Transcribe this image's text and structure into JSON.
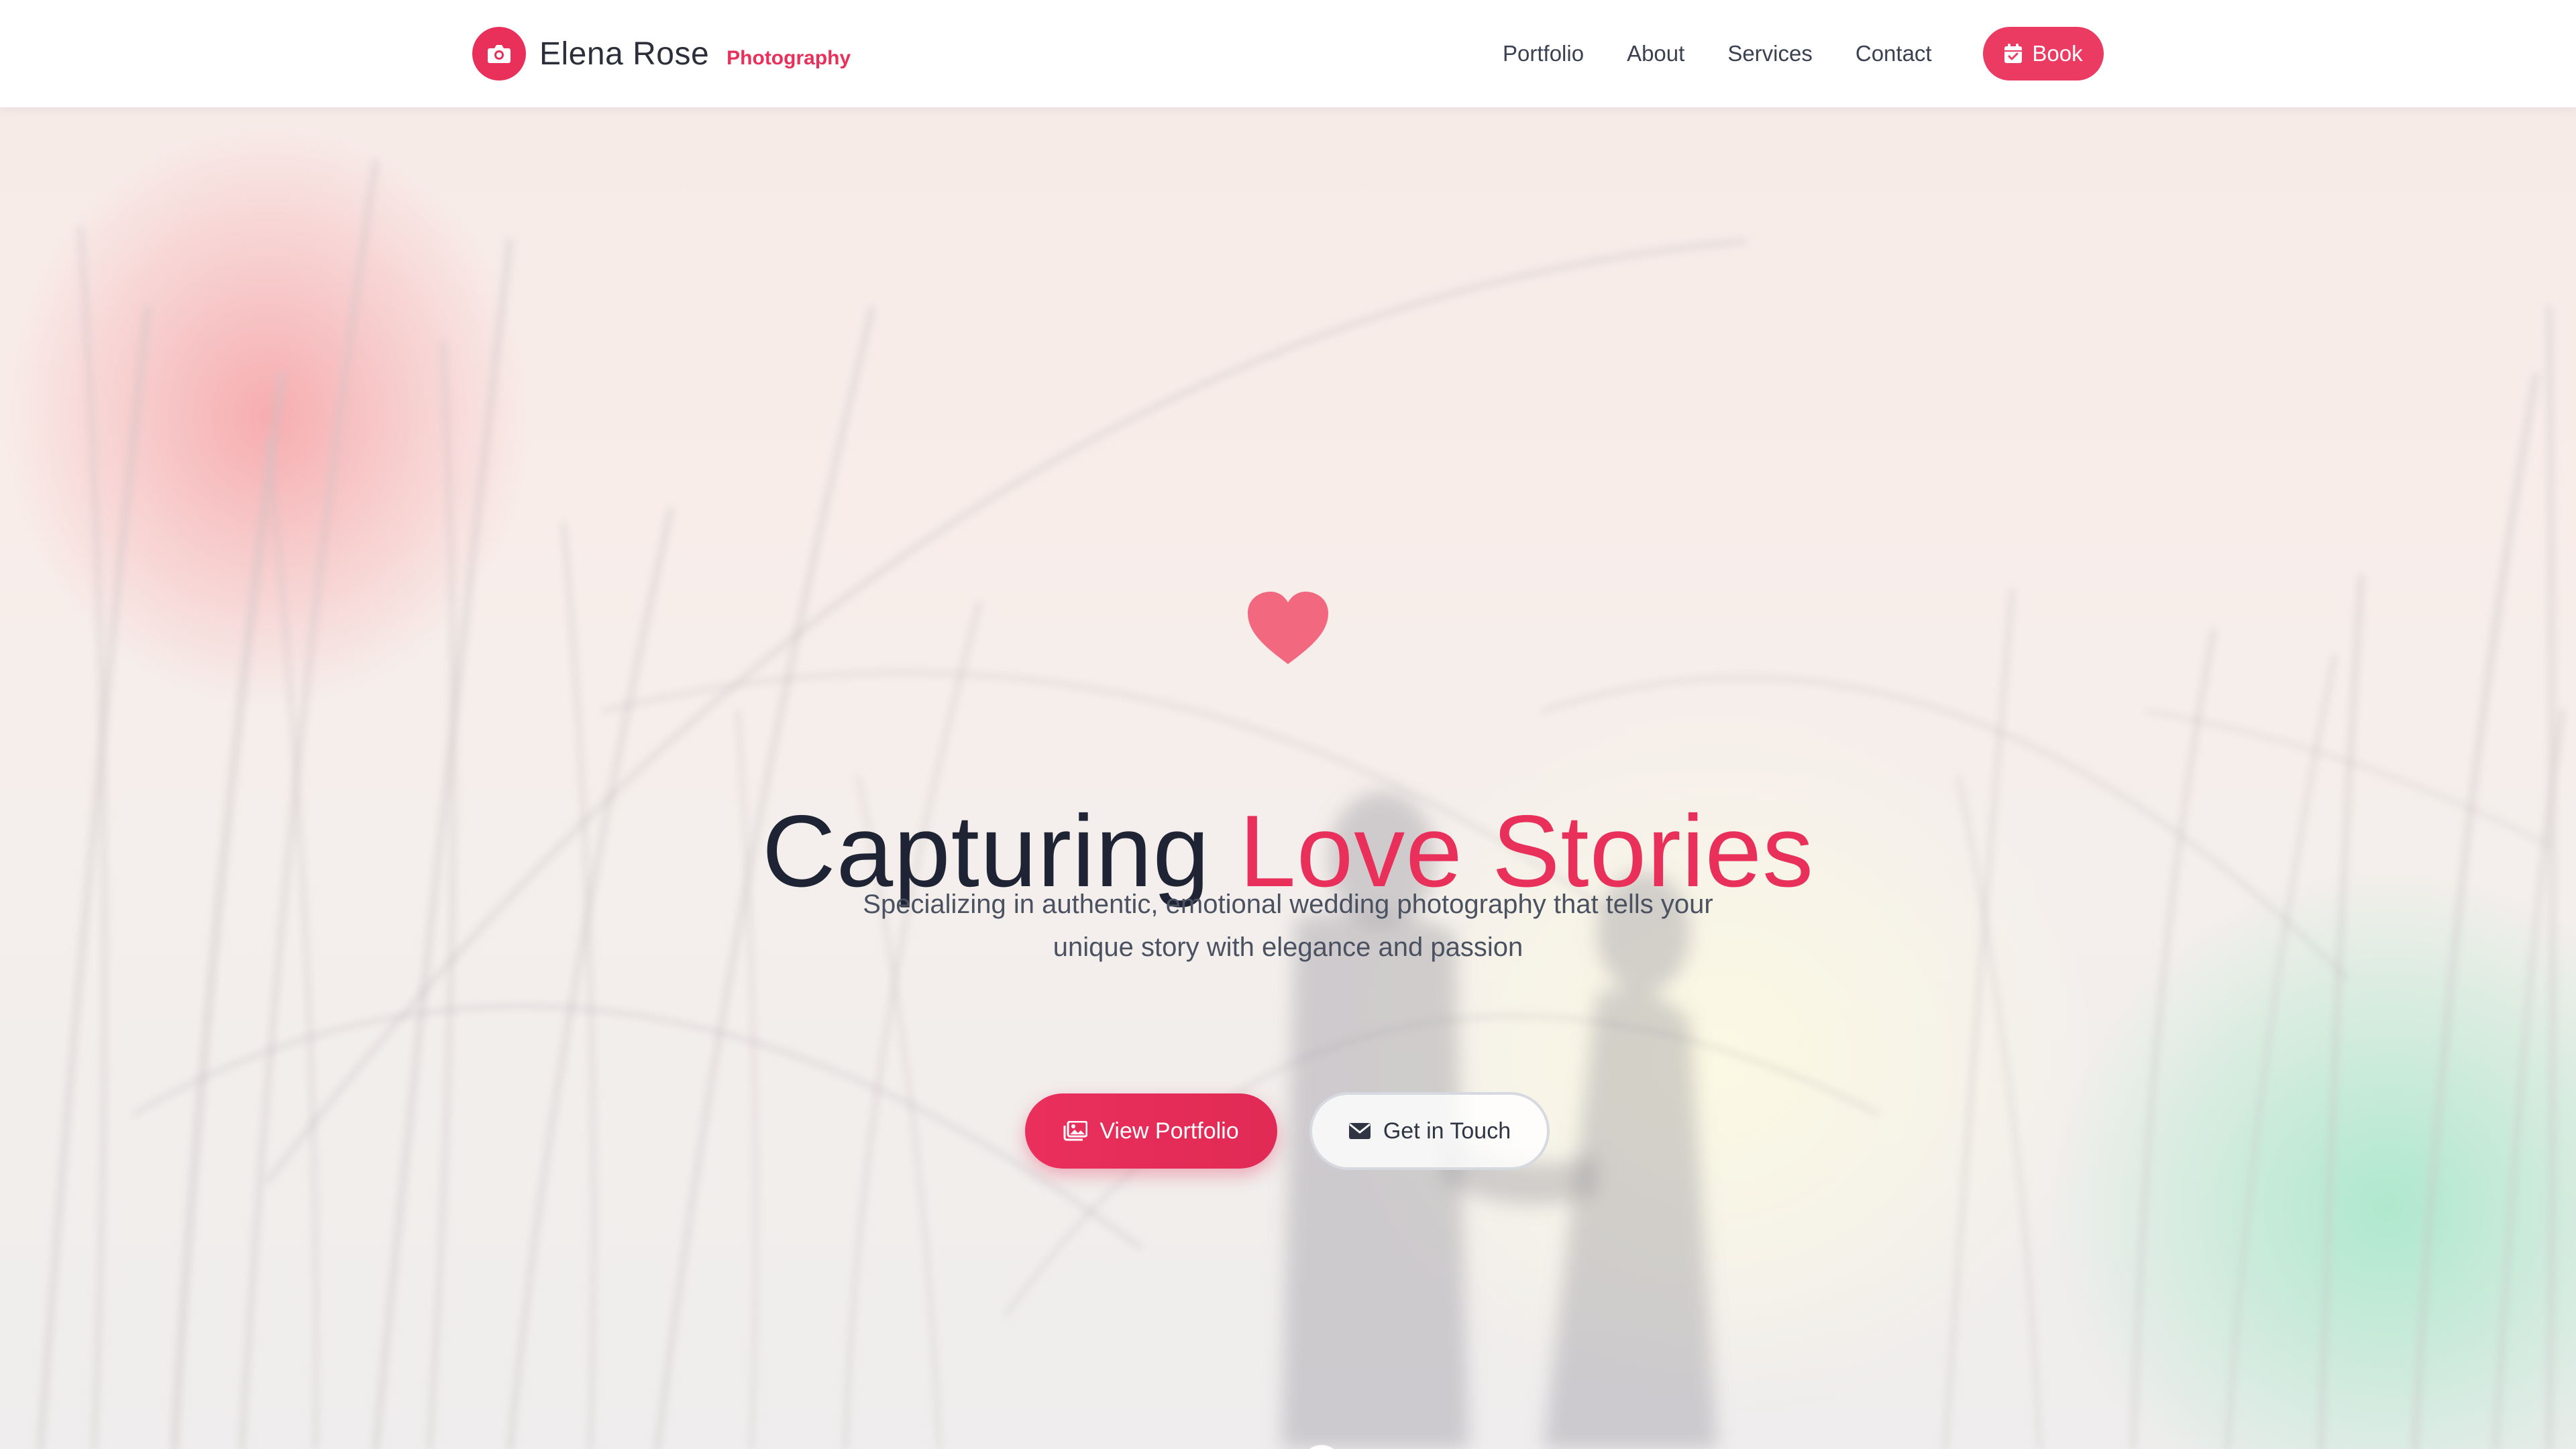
{
  "brand": {
    "name": "Elena Rose",
    "tagline": "Photography",
    "logo_icon": "camera-icon"
  },
  "nav": {
    "links": [
      "Portfolio",
      "About",
      "Services",
      "Contact"
    ],
    "book_label": "Book",
    "book_icon": "calendar-check-icon"
  },
  "hero": {
    "icon": "heart-icon",
    "title_main": "Capturing",
    "title_accent": "Love Stories",
    "subtitle": "Specializing in authentic, emotional wedding photography that tells your unique story with elegance and passion",
    "primary_button": {
      "label": "View Portfolio",
      "icon": "images-icon"
    },
    "secondary_button": {
      "label": "Get in Touch",
      "icon": "envelope-icon"
    }
  },
  "colors": {
    "accent": "#e8305a",
    "text_dark": "#1e2433",
    "text_muted": "#4a5160"
  }
}
